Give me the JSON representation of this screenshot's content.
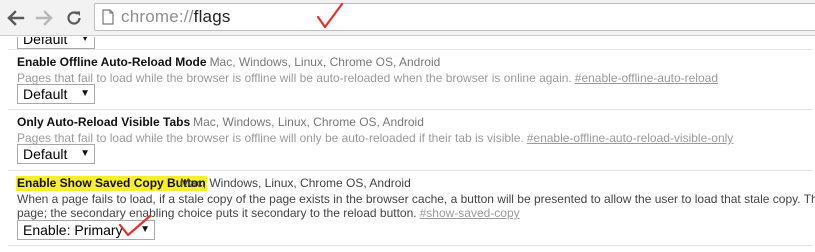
{
  "toolbar": {
    "url_scheme": "chrome://",
    "url_host": "flags",
    "back_icon": "back-arrow-icon",
    "forward_icon": "forward-arrow-icon",
    "reload_icon": "reload-icon",
    "page_icon": "page-icon"
  },
  "top_select": {
    "value": "Default"
  },
  "experiments": [
    {
      "name": "Enable Offline Auto-Reload Mode",
      "platforms": "Mac, Windows, Linux, Chrome OS, Android",
      "description": "Pages that fail to load while the browser is offline will be auto-reloaded when the browser is online again.",
      "link": "#enable-offline-auto-reload",
      "select_value": "Default"
    },
    {
      "name": "Only Auto-Reload Visible Tabs",
      "platforms": "Mac, Windows, Linux, Chrome OS, Android",
      "description": "Pages that fail to load while the browser is offline will only be auto-reloaded if their tab is visible.",
      "link": "#enable-offline-auto-reload-visible-only",
      "select_value": "Default"
    },
    {
      "name": "Enable Show Saved Copy Button",
      "platforms": "Mac, Windows, Linux, Chrome OS, Android",
      "description_line1": "When a page fails to load, if a stale copy of the page exists in the browser cache, a button will be presented to allow the user to load that stale copy. The primary enabling c",
      "description_line2": "page; the secondary enabling choice puts it secondary to the reload button.",
      "link": "#show-saved-copy",
      "select_value": "Enable: Primary"
    }
  ],
  "colors": {
    "highlight": "#f7ef2e",
    "check_mark": "#e8302e"
  }
}
